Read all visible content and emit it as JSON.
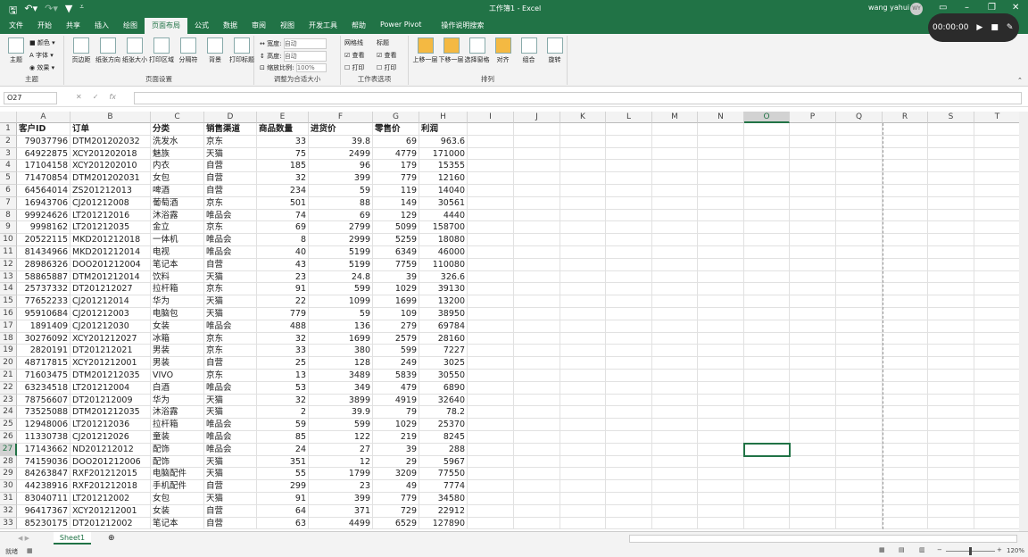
{
  "titlebar": {
    "doc_title": "工作簿1  -  Excel",
    "user": "wang yahui",
    "avatar": "WY",
    "qa_icons": [
      "save-icon",
      "undo-icon",
      "redo-icon",
      "filter-icon",
      "customize-icon"
    ]
  },
  "recorder": {
    "time": "00:00:00"
  },
  "tabs": [
    "文件",
    "开始",
    "共享",
    "插入",
    "绘图",
    "页面布局",
    "公式",
    "数据",
    "审阅",
    "视图",
    "开发工具",
    "帮助",
    "Power Pivot",
    "操作说明搜索"
  ],
  "active_tab": "页面布局",
  "ribbon": {
    "theme": {
      "label": "主题",
      "btn": "主题",
      "colors": "颜色",
      "fonts": "字体",
      "effects": "效果"
    },
    "page_setup": {
      "label": "页面设置",
      "buttons": [
        "页边距",
        "纸张方向",
        "纸张大小",
        "打印区域",
        "分隔符",
        "背景",
        "打印标题"
      ]
    },
    "scale": {
      "label": "调整为合适大小",
      "width_label": "宽度:",
      "width_value": "自动",
      "height_label": "高度:",
      "height_value": "自动",
      "scale_label": "缩放比例:",
      "scale_value": "100%"
    },
    "sheet_options": {
      "label": "工作表选项",
      "gridlines": "网格线",
      "headings": "标题",
      "view": "查看",
      "print": "打印"
    },
    "arrange": {
      "label": "排列",
      "buttons": [
        "上移一层",
        "下移一层",
        "选择窗格",
        "对齐",
        "组合",
        "旋转"
      ]
    }
  },
  "formula_bar": {
    "name_box": "O27",
    "value": ""
  },
  "columns": [
    "A",
    "B",
    "C",
    "D",
    "E",
    "F",
    "G",
    "H",
    "I",
    "J",
    "K",
    "L",
    "M",
    "N",
    "O",
    "P",
    "Q",
    "R",
    "S",
    "T"
  ],
  "selected_cell": "O27",
  "headers": [
    "客户ID",
    "订单",
    "分类",
    "销售渠道",
    "商品数量",
    "进货价",
    "零售价",
    "利润"
  ],
  "rows": [
    [
      "79037796",
      "DTM201202032",
      "洗发水",
      "京东",
      "33",
      "39.8",
      "69",
      "963.6"
    ],
    [
      "64922875",
      "XCY201202018",
      "魅族",
      "天猫",
      "75",
      "2499",
      "4779",
      "171000"
    ],
    [
      "17104158",
      "XCY201202010",
      "内衣",
      "自营",
      "185",
      "96",
      "179",
      "15355"
    ],
    [
      "71470854",
      "DTM201202031",
      "女包",
      "自营",
      "32",
      "399",
      "779",
      "12160"
    ],
    [
      "64564014",
      "ZS201212013",
      "啤酒",
      "自营",
      "234",
      "59",
      "119",
      "14040"
    ],
    [
      "16943706",
      "CJ201212008",
      "葡萄酒",
      "京东",
      "501",
      "88",
      "149",
      "30561"
    ],
    [
      "99924626",
      "LT201212016",
      "沐浴露",
      "唯品会",
      "74",
      "69",
      "129",
      "4440"
    ],
    [
      "9998162",
      "LT201212035",
      "金立",
      "京东",
      "69",
      "2799",
      "5099",
      "158700"
    ],
    [
      "20522115",
      "MKD201212018",
      "一体机",
      "唯品会",
      "8",
      "2999",
      "5259",
      "18080"
    ],
    [
      "81434966",
      "MKD201212014",
      "电视",
      "唯品会",
      "40",
      "5199",
      "6349",
      "46000"
    ],
    [
      "28986326",
      "DOO201212004",
      "笔记本",
      "自营",
      "43",
      "5199",
      "7759",
      "110080"
    ],
    [
      "58865887",
      "DTM201212014",
      "饮料",
      "天猫",
      "23",
      "24.8",
      "39",
      "326.6"
    ],
    [
      "25737332",
      "DT201212027",
      "拉杆箱",
      "京东",
      "91",
      "599",
      "1029",
      "39130"
    ],
    [
      "77652233",
      "CJ201212014",
      "华为",
      "天猫",
      "22",
      "1099",
      "1699",
      "13200"
    ],
    [
      "95910684",
      "CJ201212003",
      "电脑包",
      "天猫",
      "779",
      "59",
      "109",
      "38950"
    ],
    [
      "1891409",
      "CJ201212030",
      "女装",
      "唯品会",
      "488",
      "136",
      "279",
      "69784"
    ],
    [
      "30276092",
      "XCY201212027",
      "冰箱",
      "京东",
      "32",
      "1699",
      "2579",
      "28160"
    ],
    [
      "2820191",
      "DT201212021",
      "男装",
      "京东",
      "33",
      "380",
      "599",
      "7227"
    ],
    [
      "48717815",
      "XCY201212001",
      "男装",
      "自营",
      "25",
      "128",
      "249",
      "3025"
    ],
    [
      "71603475",
      "DTM201212035",
      "VIVO",
      "京东",
      "13",
      "3489",
      "5839",
      "30550"
    ],
    [
      "63234518",
      "LT201212004",
      "白酒",
      "唯品会",
      "53",
      "349",
      "479",
      "6890"
    ],
    [
      "78756607",
      "DT201212009",
      "华为",
      "天猫",
      "32",
      "3899",
      "4919",
      "32640"
    ],
    [
      "73525088",
      "DTM201212035",
      "沐浴露",
      "天猫",
      "2",
      "39.9",
      "79",
      "78.2"
    ],
    [
      "12948006",
      "LT201212036",
      "拉杆箱",
      "唯品会",
      "59",
      "599",
      "1029",
      "25370"
    ],
    [
      "11330738",
      "CJ201212026",
      "童装",
      "唯品会",
      "85",
      "122",
      "219",
      "8245"
    ],
    [
      "17143662",
      "ND201212012",
      "配饰",
      "唯品会",
      "24",
      "27",
      "39",
      "288"
    ],
    [
      "74159036",
      "DOO201212006",
      "配饰",
      "天猫",
      "351",
      "12",
      "29",
      "5967"
    ],
    [
      "84263847",
      "RXF201212015",
      "电脑配件",
      "天猫",
      "55",
      "1799",
      "3209",
      "77550"
    ],
    [
      "44238916",
      "RXF201212018",
      "手机配件",
      "自营",
      "299",
      "23",
      "49",
      "7774"
    ],
    [
      "83040711",
      "LT201212002",
      "女包",
      "天猫",
      "91",
      "399",
      "779",
      "34580"
    ],
    [
      "96417367",
      "XCY201212001",
      "女装",
      "自营",
      "64",
      "371",
      "729",
      "22912"
    ],
    [
      "85230175",
      "DT201212002",
      "笔记本",
      "自营",
      "63",
      "4499",
      "6529",
      "127890"
    ]
  ],
  "sheet_tabs": [
    "Sheet1"
  ],
  "status": {
    "mode": "就绪",
    "zoom": "120%"
  },
  "colors": {
    "accent": "#217346"
  }
}
